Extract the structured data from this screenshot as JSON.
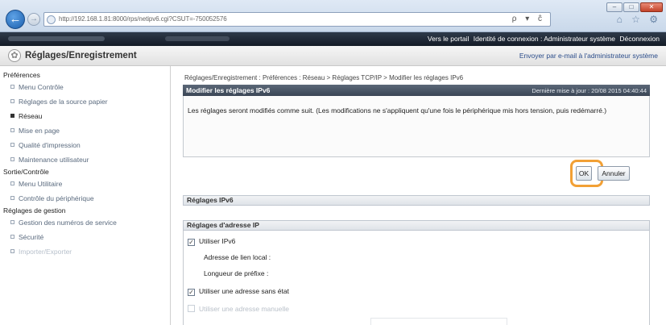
{
  "browser": {
    "url": "http://192.168.1.81:8000/rps/netipv6.cgi?CSUT=-750052576",
    "search_hint": "ρ ▾ ĉ",
    "window_controls": {
      "minimize": "–",
      "maximize": "□",
      "close": "✕"
    },
    "toolbar_icons": "⌂ ☆ ⚙"
  },
  "topbar": {
    "portal_link": "Vers le portail",
    "login_id": "Identité de connexion : Administrateur système",
    "logout_link": "Déconnexion"
  },
  "header": {
    "title": "Réglages/Enregistrement",
    "email_link": "Envoyer par e-mail à l'administrateur système"
  },
  "sidebar": {
    "groups": [
      {
        "label": "Préférences",
        "items": [
          {
            "label": "Menu Contrôle",
            "state": "normal"
          },
          {
            "label": "Réglages de la source papier",
            "state": "normal"
          },
          {
            "label": "Réseau",
            "state": "active"
          },
          {
            "label": "Mise en page",
            "state": "normal"
          },
          {
            "label": "Qualité d'impression",
            "state": "normal"
          },
          {
            "label": "Maintenance utilisateur",
            "state": "normal"
          }
        ]
      },
      {
        "label": "Sortie/Contrôle",
        "items": [
          {
            "label": "Menu Utilitaire",
            "state": "normal"
          },
          {
            "label": "Contrôle du périphérique",
            "state": "normal"
          }
        ]
      },
      {
        "label": "Réglages de gestion",
        "items": [
          {
            "label": "Gestion des numéros de service",
            "state": "normal"
          },
          {
            "label": "Sécurité",
            "state": "normal"
          },
          {
            "label": "Importer/Exporter",
            "state": "faded"
          }
        ]
      }
    ]
  },
  "main": {
    "breadcrumb": "Réglages/Enregistrement : Préférences : Réseau > Réglages TCP/IP > Modifier les réglages IPv6",
    "panel_title": "Modifier les réglages IPv6",
    "last_update": "Dernière mise à jour : 20/08 2015 04:40:44",
    "message": "Les réglages seront modifiés comme suit. (Les modifications ne s'appliquent qu'une fois le périphérique mis hors tension, puis redémarré.)",
    "ok_label": "OK",
    "cancel_label": "Annuler",
    "section_ipv6": "Réglages IPv6",
    "section_ip": "Réglages d'adresse IP",
    "use_ipv6": {
      "label": "Utiliser IPv6",
      "checked": true
    },
    "link_local_label": "Adresse de lien local :",
    "prefix_length_label": "Longueur de préfixe :",
    "stateless": {
      "label": "Utiliser une adresse sans état",
      "checked": true
    },
    "manual": {
      "label": "Utiliser une adresse manuelle",
      "checked": false
    }
  }
}
